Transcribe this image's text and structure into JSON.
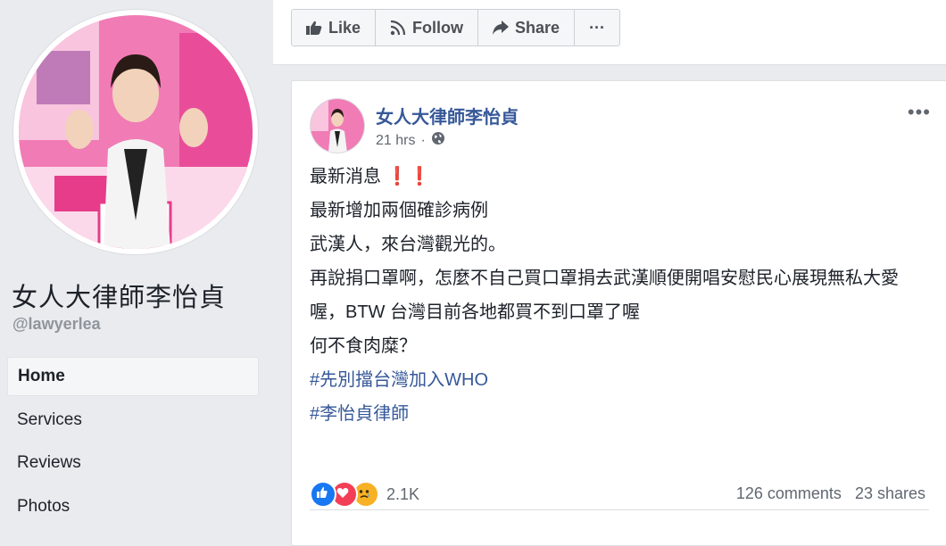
{
  "page": {
    "name": "女人大律師李怡貞",
    "handle": "@lawyerlea"
  },
  "nav": {
    "items": [
      "Home",
      "Services",
      "Reviews",
      "Photos"
    ],
    "active": "Home"
  },
  "actions": {
    "like_label": "Like",
    "follow_label": "Follow",
    "share_label": "Share",
    "more_label": "···"
  },
  "post": {
    "author": "女人大律師李怡貞",
    "time": "21 hrs",
    "separator": "·",
    "menu_label": "•••",
    "lines": {
      "l1": "最新消息",
      "l1_marks": "❗❗",
      "l2": "最新增加兩個確診病例",
      "l3": "武漢人，來台灣觀光的。",
      "l4": "再說捐口罩啊，怎麼不自己買口罩捐去武漢順便開唱安慰民心展現無私大愛",
      "l5": "喔，BTW 台灣目前各地都買不到口罩了喔",
      "l6": "何不食肉糜？"
    },
    "hashtags": [
      "#先別擋台灣加入WHO",
      "#李怡貞律師"
    ],
    "reaction_count": "2.1K",
    "comments": "126 comments",
    "shares": "23 shares"
  },
  "colors": {
    "link_blue": "#365899",
    "like_blue": "#1877f2",
    "love_red": "#f33e58",
    "sad_yellow": "#f7b125"
  }
}
